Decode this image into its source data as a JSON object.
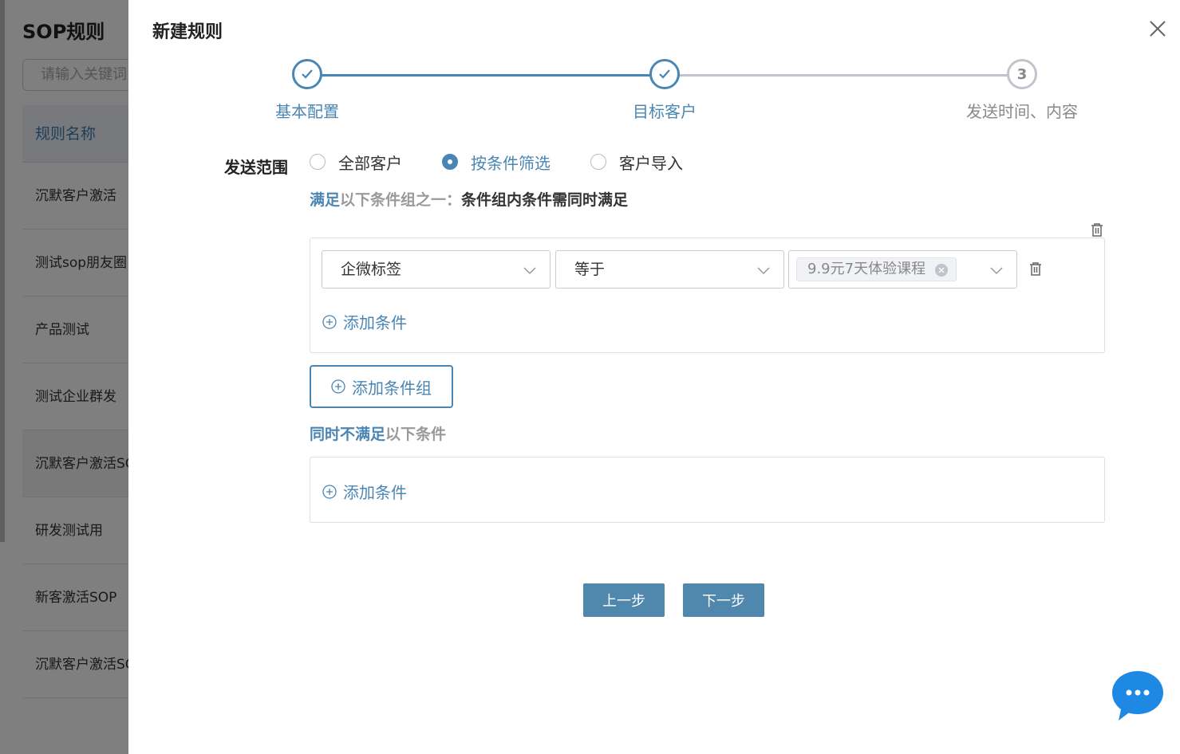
{
  "background": {
    "title": "SOP规则",
    "search_placeholder": "请输入关键词",
    "table_header": "规则名称",
    "rows": [
      "沉默客户激活",
      "测试sop朋友圈",
      "产品测试",
      "测试企业群发",
      "沉默客户激活SOP",
      "研发测试用",
      "新客激活SOP",
      "沉默客户激活SOP"
    ]
  },
  "drawer": {
    "title": "新建规则",
    "steps": [
      {
        "label": "基本配置",
        "status": "done"
      },
      {
        "label": "目标客户",
        "status": "done"
      },
      {
        "label": "发送时间、内容",
        "number": "3",
        "status": "pending"
      }
    ],
    "range_label": "发送范围",
    "radios": [
      {
        "label": "全部客户",
        "checked": false
      },
      {
        "label": "按条件筛选",
        "checked": true
      },
      {
        "label": "客户导入",
        "checked": false
      }
    ],
    "cond_title": {
      "part1": "满足",
      "part2": "以下条件组之一：",
      "part3": "条件组内条件需同时满足"
    },
    "condition": {
      "field": "企微标签",
      "operator": "等于",
      "tag": "9.9元7天体验课程"
    },
    "add_condition": "添加条件",
    "add_group": "添加条件组",
    "not_title": {
      "part1": "同时不满足",
      "part2": "以下条件"
    },
    "add_condition_2": "添加条件",
    "prev_button": "上一步",
    "next_button": "下一步"
  },
  "colors": {
    "accent": "#4a86b4",
    "button": "#4f87ad",
    "chat": "#1e88e5"
  }
}
